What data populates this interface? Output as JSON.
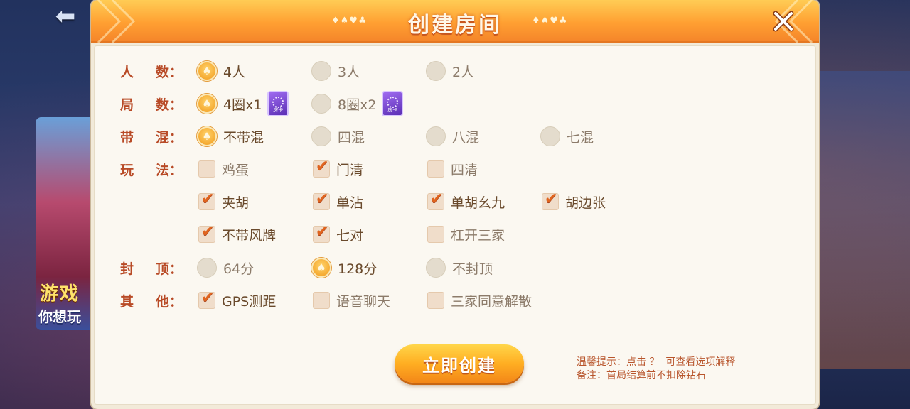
{
  "dialog": {
    "title": "创建房间",
    "title_ornament": "♦♠♥♣",
    "create_button": "立即创建",
    "tips": {
      "line1": "温馨提示：点击 ？  可查看选项解释",
      "line2": "备注：首局结算前不扣除钻石"
    }
  },
  "card_label": "房卡",
  "background": {
    "banner_line1": "游戏",
    "banner_line2": "你想玩"
  },
  "rows": [
    {
      "label_a": "人",
      "label_b": "数：",
      "options": [
        {
          "text": "4人",
          "selected": true
        },
        {
          "text": "3人",
          "selected": false
        },
        {
          "text": "2人",
          "selected": false
        }
      ]
    },
    {
      "label_a": "局",
      "label_b": "数：",
      "options": [
        {
          "text": "4圈x1",
          "selected": true
        },
        {
          "text": "8圈x2",
          "selected": false
        }
      ]
    },
    {
      "label_a": "带",
      "label_b": "混：",
      "options": [
        {
          "text": "不带混",
          "selected": true
        },
        {
          "text": "四混",
          "selected": false
        },
        {
          "text": "八混",
          "selected": false
        },
        {
          "text": "七混",
          "selected": false
        }
      ]
    },
    {
      "label_a": "玩",
      "label_b": "法：",
      "options": [
        {
          "text": "鸡蛋",
          "checked": false
        },
        {
          "text": "门清",
          "checked": true
        },
        {
          "text": "四清",
          "checked": false
        },
        {
          "text": "夹胡",
          "checked": true
        },
        {
          "text": "单沾",
          "checked": true
        },
        {
          "text": "单胡幺九",
          "checked": true
        },
        {
          "text": "胡边张",
          "checked": true
        },
        {
          "text": "不带风牌",
          "checked": true
        },
        {
          "text": "七对",
          "checked": true
        },
        {
          "text": "杠开三家",
          "checked": false
        }
      ]
    },
    {
      "label_a": "封",
      "label_b": "顶：",
      "options": [
        {
          "text": "64分",
          "selected": false
        },
        {
          "text": "128分",
          "selected": true
        },
        {
          "text": "不封顶",
          "selected": false
        }
      ]
    },
    {
      "label_a": "其",
      "label_b": "他：",
      "options": [
        {
          "text": "GPS测距",
          "checked": true
        },
        {
          "text": "语音聊天",
          "checked": false
        },
        {
          "text": "三家同意解散",
          "checked": false
        }
      ]
    }
  ]
}
